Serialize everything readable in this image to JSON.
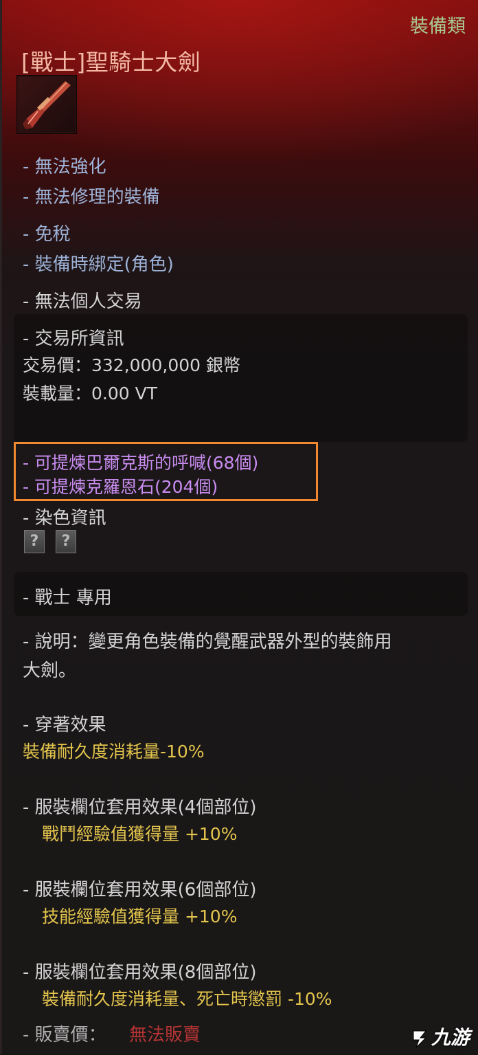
{
  "header": {
    "category": "裝備類",
    "title": "[戰士]聖騎士大劍"
  },
  "properties": [
    "- 無法強化",
    "- 無法修理的裝備",
    "- 免稅",
    "- 裝備時綁定(角色)"
  ],
  "trade_note": "- 無法個人交易",
  "market": {
    "heading": "- 交易所資訊",
    "price": "交易價：332,000,000 銀幣",
    "weight": "裝載量：0.00 VT"
  },
  "extraction": [
    "- 可提煉巴爾克斯的呼喊(68個)",
    "- 可提煉克羅恩石(204個)"
  ],
  "dye": {
    "heading": "- 染色資訊",
    "slots": [
      "?",
      "?"
    ]
  },
  "class_restriction": "- 戰士 專用",
  "description": {
    "line1": "- 說明：變更角色裝備的覺醒武器外型的裝飾用",
    "line2": "大劍。"
  },
  "wear_effect": {
    "heading": "- 穿著效果",
    "value": "裝備耐久度消耗量-10%"
  },
  "set_effects": [
    {
      "heading": "- 服裝欄位套用效果(4個部位)",
      "value": "戰鬥經驗值獲得量 +10%"
    },
    {
      "heading": "- 服裝欄位套用效果(6個部位)",
      "value": "技能經驗值獲得量 +10%"
    },
    {
      "heading": "- 服裝欄位套用效果(8個部位)",
      "value": "裝備耐久度消耗量、死亡時懲罰 -10%"
    }
  ],
  "sell": {
    "label": "- 販賣價：",
    "value": "無法販賣"
  },
  "watermark": "九游",
  "colors": {
    "category": "#a9c991",
    "title": "#f3b9a4",
    "property": "#9db3d8",
    "extraction": "#c98cf0",
    "effect": "#e3c54d",
    "unsellable": "#ce3a3a",
    "highlight_box": "#f0892f"
  },
  "icons": {
    "item": "greatsword-icon",
    "dye_slot": "unknown-dye-icon",
    "watermark": "jiuyou-logo-icon"
  }
}
